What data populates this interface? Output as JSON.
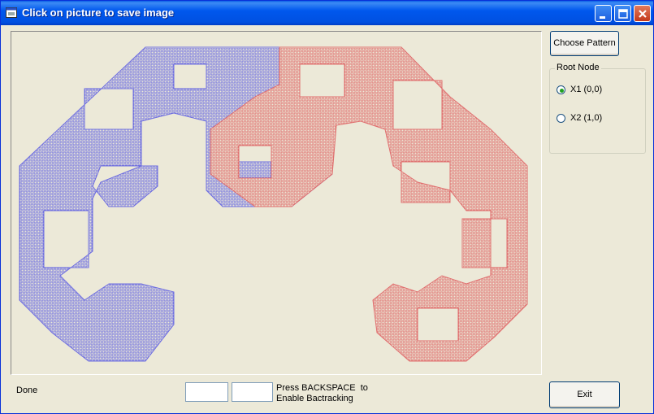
{
  "window": {
    "title": "Click on picture to save image"
  },
  "title_icon": "app-icon",
  "buttons": {
    "choose_pattern": "Choose Pattern",
    "exit": "Exit"
  },
  "root_node": {
    "legend": "Root Node",
    "options": [
      {
        "label": "X1 (0,0)",
        "selected": true
      },
      {
        "label": "X2 (1,0)",
        "selected": false
      }
    ]
  },
  "status": {
    "text": "Done"
  },
  "inputs": {
    "box1": "",
    "box2": ""
  },
  "hint": {
    "line1": "Press BACKSPACE  to",
    "line2": "Enable Bactracking"
  },
  "colors": {
    "blue_curve": "#6e6ee0",
    "red_curve": "#e06e6e",
    "title_bar": "#0055e5"
  }
}
